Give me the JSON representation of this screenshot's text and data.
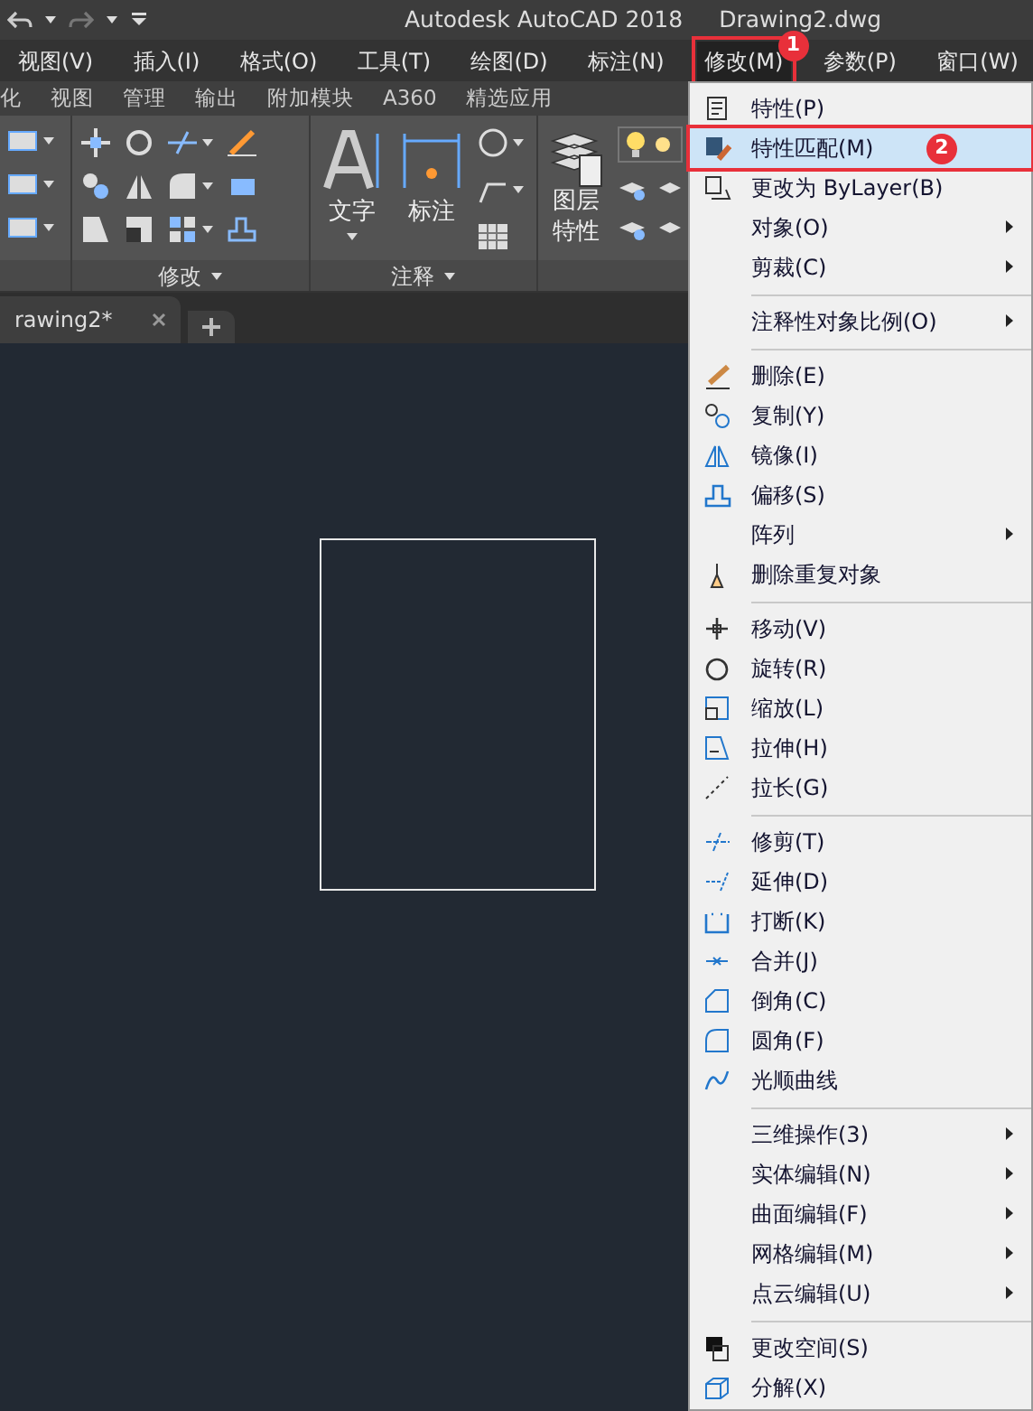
{
  "title_bar": {
    "app": "Autodesk AutoCAD 2018",
    "document": "Drawing2.dwg"
  },
  "menu_bar": [
    {
      "label": "视图(V)",
      "selected": false
    },
    {
      "label": "插入(I)",
      "selected": false
    },
    {
      "label": "格式(O)",
      "selected": false
    },
    {
      "label": "工具(T)",
      "selected": false
    },
    {
      "label": "绘图(D)",
      "selected": false
    },
    {
      "label": "标注(N)",
      "selected": false
    },
    {
      "label": "修改(M)",
      "selected": true,
      "callout": "1"
    },
    {
      "label": "参数(P)",
      "selected": false
    },
    {
      "label": "窗口(W)",
      "selected": false
    }
  ],
  "ribbon_tabs": [
    "化",
    "视图",
    "管理",
    "输出",
    "附加模块",
    "A360",
    "精选应用"
  ],
  "ribbon": {
    "panels": [
      {
        "title": "修改"
      },
      {
        "title": "注释",
        "buttons": [
          "文字",
          "标注"
        ]
      },
      {
        "buttons": [
          [
            "图层",
            "特性"
          ]
        ]
      }
    ]
  },
  "document_tab": {
    "label": "rawing2*"
  },
  "modify_menu": [
    {
      "kind": "item",
      "label": "特性(P)",
      "selected": false
    },
    {
      "kind": "item",
      "label": "特性匹配(M)",
      "selected": true,
      "callout": "2"
    },
    {
      "kind": "item",
      "label": "更改为 ByLayer(B)",
      "selected": false
    },
    {
      "kind": "item",
      "label": "对象(O)",
      "selected": false,
      "submenu": true
    },
    {
      "kind": "item",
      "label": "剪裁(C)",
      "selected": false,
      "submenu": true
    },
    {
      "kind": "separator"
    },
    {
      "kind": "item",
      "label": "注释性对象比例(O)",
      "selected": false,
      "submenu": true
    },
    {
      "kind": "separator"
    },
    {
      "kind": "item",
      "label": "删除(E)",
      "selected": false
    },
    {
      "kind": "item",
      "label": "复制(Y)",
      "selected": false
    },
    {
      "kind": "item",
      "label": "镜像(I)",
      "selected": false
    },
    {
      "kind": "item",
      "label": "偏移(S)",
      "selected": false
    },
    {
      "kind": "item",
      "label": "阵列",
      "selected": false,
      "submenu": true
    },
    {
      "kind": "item",
      "label": "删除重复对象",
      "selected": false
    },
    {
      "kind": "separator"
    },
    {
      "kind": "item",
      "label": "移动(V)",
      "selected": false
    },
    {
      "kind": "item",
      "label": "旋转(R)",
      "selected": false
    },
    {
      "kind": "item",
      "label": "缩放(L)",
      "selected": false
    },
    {
      "kind": "item",
      "label": "拉伸(H)",
      "selected": false
    },
    {
      "kind": "item",
      "label": "拉长(G)",
      "selected": false
    },
    {
      "kind": "separator"
    },
    {
      "kind": "item",
      "label": "修剪(T)",
      "selected": false
    },
    {
      "kind": "item",
      "label": "延伸(D)",
      "selected": false
    },
    {
      "kind": "item",
      "label": "打断(K)",
      "selected": false
    },
    {
      "kind": "item",
      "label": "合并(J)",
      "selected": false
    },
    {
      "kind": "item",
      "label": "倒角(C)",
      "selected": false
    },
    {
      "kind": "item",
      "label": "圆角(F)",
      "selected": false
    },
    {
      "kind": "item",
      "label": "光顺曲线",
      "selected": false
    },
    {
      "kind": "separator"
    },
    {
      "kind": "item",
      "label": "三维操作(3)",
      "selected": false,
      "submenu": true
    },
    {
      "kind": "item",
      "label": "实体编辑(N)",
      "selected": false,
      "submenu": true
    },
    {
      "kind": "item",
      "label": "曲面编辑(F)",
      "selected": false,
      "submenu": true
    },
    {
      "kind": "item",
      "label": "网格编辑(M)",
      "selected": false,
      "submenu": true
    },
    {
      "kind": "item",
      "label": "点云编辑(U)",
      "selected": false,
      "submenu": true
    },
    {
      "kind": "separator"
    },
    {
      "kind": "item",
      "label": "更改空间(S)",
      "selected": false
    },
    {
      "kind": "item",
      "label": "分解(X)",
      "selected": false
    }
  ]
}
